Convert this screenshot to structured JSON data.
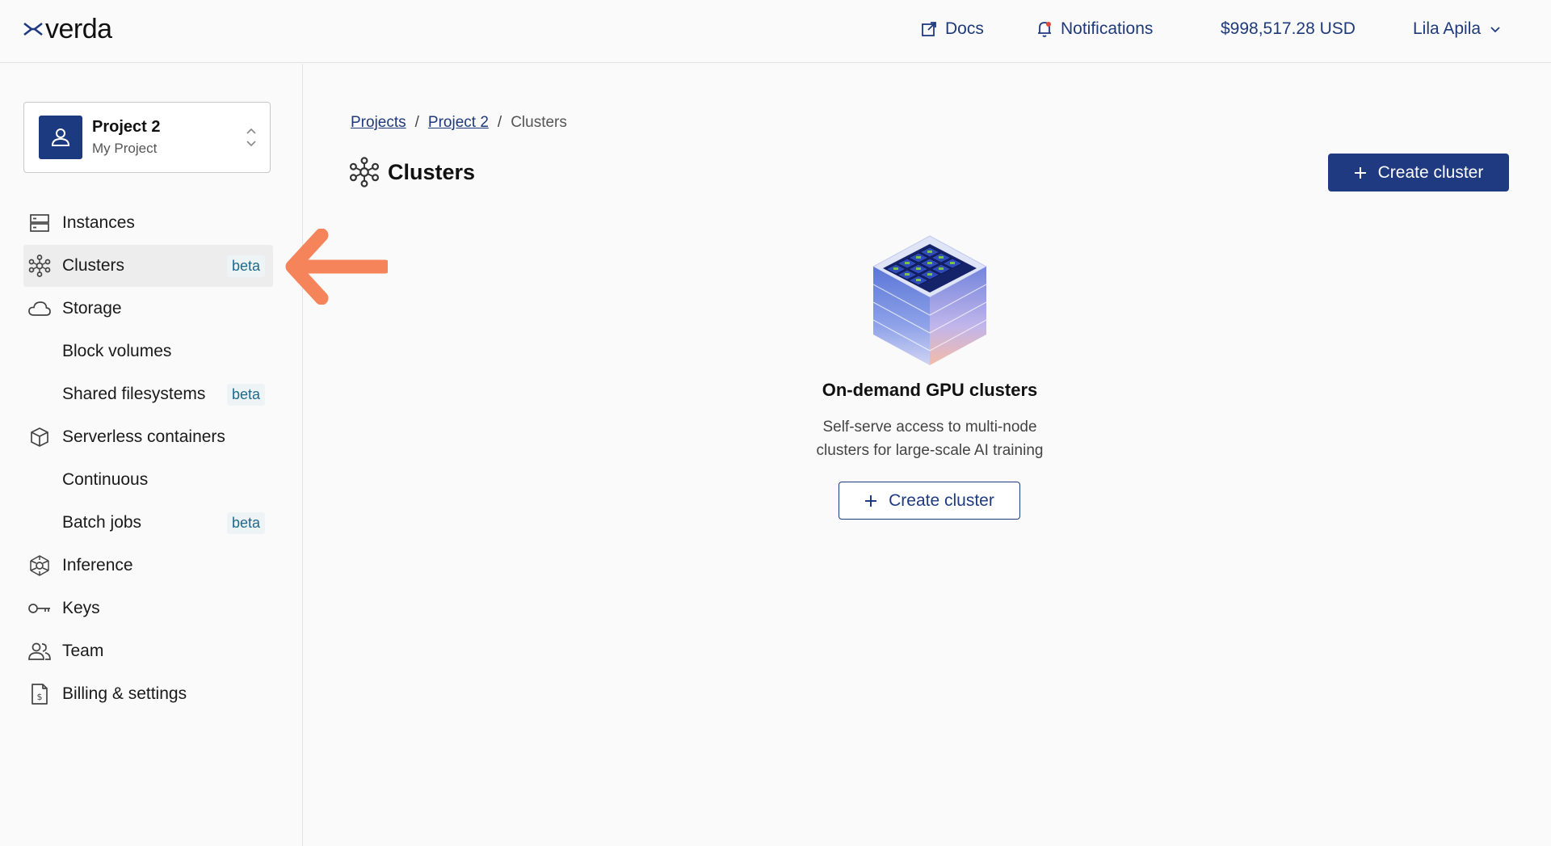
{
  "brand": {
    "name": "verda",
    "accent": "#1f3a80",
    "callout_color": "#f5845a"
  },
  "topbar": {
    "docs_label": "Docs",
    "docs_icon": "external-link-icon",
    "notifications_label": "Notifications",
    "notifications_icon": "bell-icon",
    "balance": "$998,517.28 USD",
    "user_name": "Lila Apila",
    "user_icon": "chevron-down-icon"
  },
  "sidebar": {
    "project": {
      "name": "Project 2",
      "subtitle": "My Project"
    },
    "items": [
      {
        "label": "Instances",
        "icon": "server-icon"
      },
      {
        "label": "Clusters",
        "icon": "cluster-icon",
        "badge": "beta",
        "active": true
      },
      {
        "label": "Storage",
        "icon": "cloud-icon"
      },
      {
        "label": "Block volumes"
      },
      {
        "label": "Shared filesystems",
        "badge": "beta"
      },
      {
        "label": "Serverless containers",
        "icon": "box-icon"
      },
      {
        "label": "Continuous"
      },
      {
        "label": "Batch jobs",
        "badge": "beta"
      },
      {
        "label": "Inference",
        "icon": "inference-icon"
      },
      {
        "label": "Keys",
        "icon": "key-icon"
      },
      {
        "label": "Team",
        "icon": "team-icon"
      },
      {
        "label": "Billing & settings",
        "icon": "billing-icon"
      }
    ]
  },
  "main": {
    "breadcrumb": {
      "root": "Projects",
      "project": "Project 2",
      "current": "Clusters",
      "separator": "/"
    },
    "page_title": "Clusters",
    "create_button_label": "Create cluster",
    "empty_state": {
      "title": "On-demand GPU clusters",
      "description_line1": "Self-serve access to multi-node",
      "description_line2": "clusters for large-scale AI training",
      "button_label": "Create cluster"
    }
  }
}
